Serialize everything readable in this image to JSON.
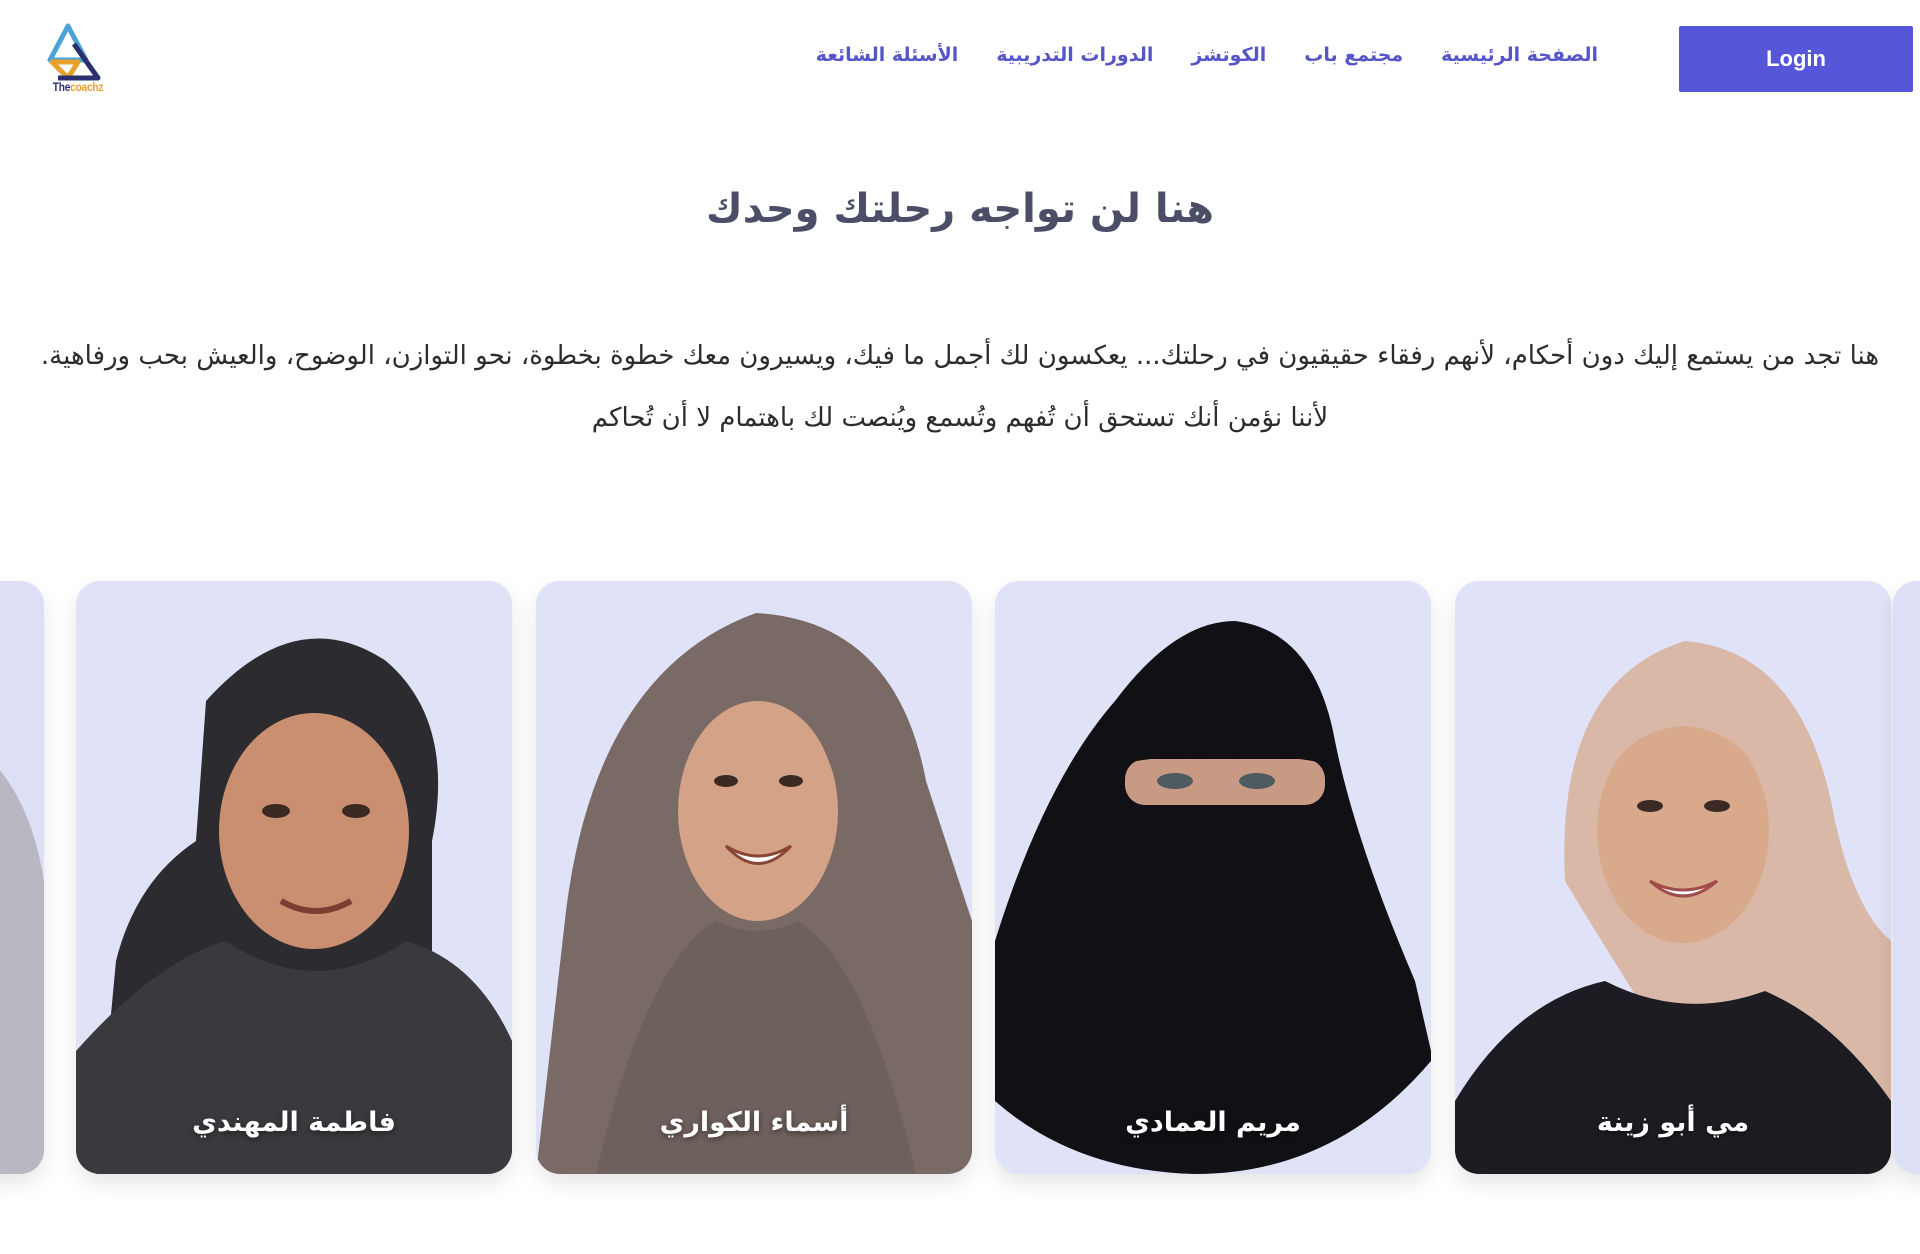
{
  "header": {
    "login_label": "Login",
    "logo": {
      "text_part1": "The",
      "text_part2": "coachz"
    },
    "nav": [
      {
        "label": "الصفحة الرئيسية"
      },
      {
        "label": "مجتمع باب"
      },
      {
        "label": "الكوتشز"
      },
      {
        "label": "الدورات التدريبية"
      },
      {
        "label": "الأسئلة الشائعة"
      }
    ]
  },
  "hero": {
    "title": "هنا لن تواجه رحلتك وحدك",
    "description": "هنا تجد من يستمع إليك دون أحكام، لأنهم رفقاء حقيقيون في رحلتك... يعكسون لك أجمل ما فيك، ويسيرون معك خطوة بخطوة، نحو التوازن، الوضوح، والعيش بحب ورفاهية. لأننا نؤمن أنك تستحق أن تُفهم وتُسمع ويُنصت لك باهتمام لا أن تُحاكم"
  },
  "coaches": [
    {
      "name": "مي أبو زينة",
      "hijab_color": "#d9b8a8",
      "outfit_color": "#1c1c22"
    },
    {
      "name": "مريم العمادي",
      "hijab_color": "#111115",
      "outfit_color": "#111115"
    },
    {
      "name": "أسماء الكواري",
      "hijab_color": "#7a6a66",
      "outfit_color": "#6e605c"
    },
    {
      "name": "فاطمة المهندي",
      "hijab_color": "#2c2b2f",
      "outfit_color": "#3a393d"
    }
  ],
  "colors": {
    "accent": "#5656d8",
    "nav_text": "#5656c8",
    "card_bg": "#e0e2f8",
    "title": "#4b4e66"
  }
}
